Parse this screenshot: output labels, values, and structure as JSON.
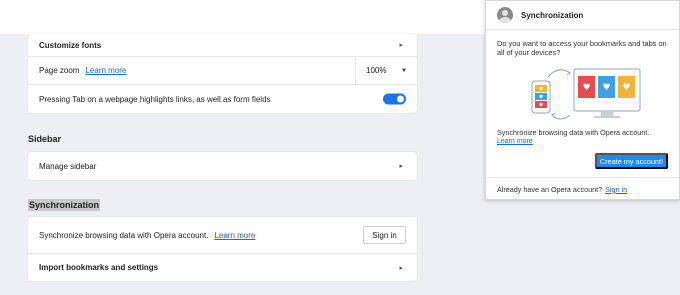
{
  "settings": {
    "customize_fonts": "Customize fonts",
    "page_zoom_label": "Page zoom",
    "page_zoom_link": "Learn more",
    "page_zoom_value": "100%",
    "tab_highlight_label": "Pressing Tab on a webpage highlights links, as well as form fields",
    "tab_highlight_enabled": true,
    "sidebar_heading": "Sidebar",
    "manage_sidebar": "Manage sidebar",
    "sync_heading": "Synchronization",
    "sync_row_label": "Synchronize browsing data with Opera account.",
    "sync_row_link": "Learn more",
    "sign_in_button": "Sign in",
    "import_bookmarks": "Import bookmarks and settings"
  },
  "popup": {
    "title": "Synchronization",
    "question": "Do you want to access your bookmarks and tabs on all of your devices?",
    "description": "Synchronize browsing data with Opera account.",
    "learn_more": "Learn more",
    "create_button": "Create my account!",
    "footer_text": "Already have an Opera account?",
    "footer_link": "Sign in"
  },
  "colors": {
    "accent": "#1a73e8",
    "button_blue": "#1a8cf0",
    "link": "#1b6ae0",
    "background": "#eceff3",
    "heart_red": "#e84c4c",
    "heart_blue": "#3fa0e6",
    "heart_yellow": "#f0b43a"
  }
}
